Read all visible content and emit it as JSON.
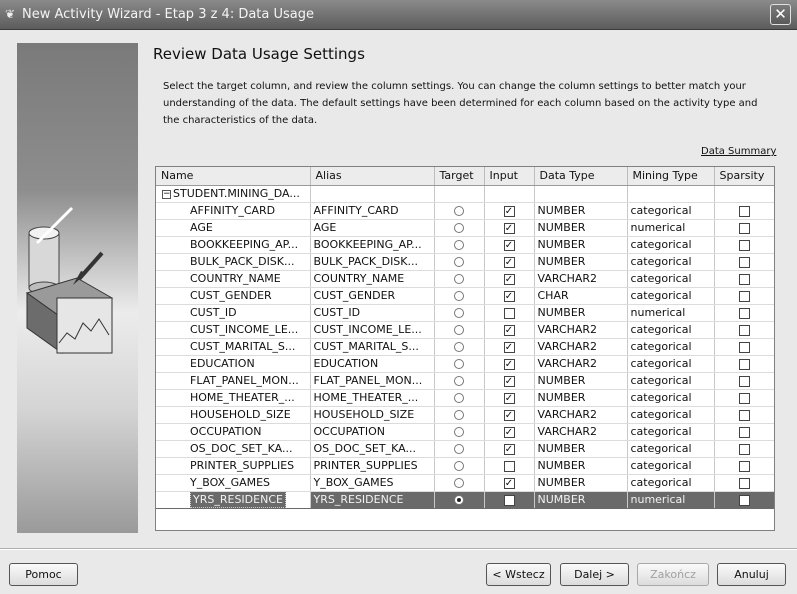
{
  "window": {
    "title": "New Activity Wizard - Etap 3 z 4: Data Usage",
    "close_label": "✕",
    "app_icon": "oracle-icon"
  },
  "page": {
    "heading": "Review Data Usage Settings",
    "description": "Select the target column, and review the column settings. You can change the column settings to better match your understanding of the data. The default settings have been determined for each column based on the activity type and the characteristics of the data.",
    "summary_link": "Data Summary"
  },
  "table": {
    "headers": {
      "name": "Name",
      "alias": "Alias",
      "target": "Target",
      "input": "Input",
      "data_type": "Data Type",
      "mining_type": "Mining Type",
      "sparsity": "Sparsity"
    },
    "group": {
      "toggle": "−",
      "label": "STUDENT.MINING_DA..."
    },
    "rows": [
      {
        "name": "AFFINITY_CARD",
        "alias": "AFFINITY_CARD",
        "target": false,
        "input": true,
        "data_type": "NUMBER",
        "mining_type": "categorical",
        "sparsity": false
      },
      {
        "name": "AGE",
        "alias": "AGE",
        "target": false,
        "input": true,
        "data_type": "NUMBER",
        "mining_type": "numerical",
        "sparsity": false
      },
      {
        "name": "BOOKKEEPING_AP...",
        "alias": "BOOKKEEPING_AP...",
        "target": false,
        "input": true,
        "data_type": "NUMBER",
        "mining_type": "categorical",
        "sparsity": false
      },
      {
        "name": "BULK_PACK_DISK...",
        "alias": "BULK_PACK_DISK...",
        "target": false,
        "input": true,
        "data_type": "NUMBER",
        "mining_type": "categorical",
        "sparsity": false
      },
      {
        "name": "COUNTRY_NAME",
        "alias": "COUNTRY_NAME",
        "target": false,
        "input": true,
        "data_type": "VARCHAR2",
        "mining_type": "categorical",
        "sparsity": false
      },
      {
        "name": "CUST_GENDER",
        "alias": "CUST_GENDER",
        "target": false,
        "input": true,
        "data_type": "CHAR",
        "mining_type": "categorical",
        "sparsity": false
      },
      {
        "name": "CUST_ID",
        "alias": "CUST_ID",
        "target": false,
        "input": false,
        "data_type": "NUMBER",
        "mining_type": "numerical",
        "sparsity": false
      },
      {
        "name": "CUST_INCOME_LE...",
        "alias": "CUST_INCOME_LE...",
        "target": false,
        "input": true,
        "data_type": "VARCHAR2",
        "mining_type": "categorical",
        "sparsity": false
      },
      {
        "name": "CUST_MARITAL_S...",
        "alias": "CUST_MARITAL_S...",
        "target": false,
        "input": true,
        "data_type": "VARCHAR2",
        "mining_type": "categorical",
        "sparsity": false
      },
      {
        "name": "EDUCATION",
        "alias": "EDUCATION",
        "target": false,
        "input": true,
        "data_type": "VARCHAR2",
        "mining_type": "categorical",
        "sparsity": false
      },
      {
        "name": "FLAT_PANEL_MON...",
        "alias": "FLAT_PANEL_MON...",
        "target": false,
        "input": true,
        "data_type": "NUMBER",
        "mining_type": "categorical",
        "sparsity": false
      },
      {
        "name": "HOME_THEATER_...",
        "alias": "HOME_THEATER_...",
        "target": false,
        "input": true,
        "data_type": "NUMBER",
        "mining_type": "categorical",
        "sparsity": false
      },
      {
        "name": "HOUSEHOLD_SIZE",
        "alias": "HOUSEHOLD_SIZE",
        "target": false,
        "input": true,
        "data_type": "VARCHAR2",
        "mining_type": "categorical",
        "sparsity": false
      },
      {
        "name": "OCCUPATION",
        "alias": "OCCUPATION",
        "target": false,
        "input": true,
        "data_type": "VARCHAR2",
        "mining_type": "categorical",
        "sparsity": false
      },
      {
        "name": "OS_DOC_SET_KA...",
        "alias": "OS_DOC_SET_KA...",
        "target": false,
        "input": true,
        "data_type": "NUMBER",
        "mining_type": "categorical",
        "sparsity": false
      },
      {
        "name": "PRINTER_SUPPLIES",
        "alias": "PRINTER_SUPPLIES",
        "target": false,
        "input": false,
        "data_type": "NUMBER",
        "mining_type": "categorical",
        "sparsity": false
      },
      {
        "name": "Y_BOX_GAMES",
        "alias": "Y_BOX_GAMES",
        "target": false,
        "input": true,
        "data_type": "NUMBER",
        "mining_type": "categorical",
        "sparsity": false
      },
      {
        "name": "YRS_RESIDENCE",
        "alias": "YRS_RESIDENCE",
        "target": true,
        "input": false,
        "data_type": "NUMBER",
        "mining_type": "numerical",
        "sparsity": false,
        "selected": true
      }
    ]
  },
  "buttons": {
    "help": "Pomoc",
    "back": "< Wstecz",
    "next": "Dalej >",
    "finish": "Zakończ",
    "cancel": "Anuluj"
  },
  "colors": {
    "selection": "#6a6a6a",
    "titlebar": "#6e6e6e"
  }
}
